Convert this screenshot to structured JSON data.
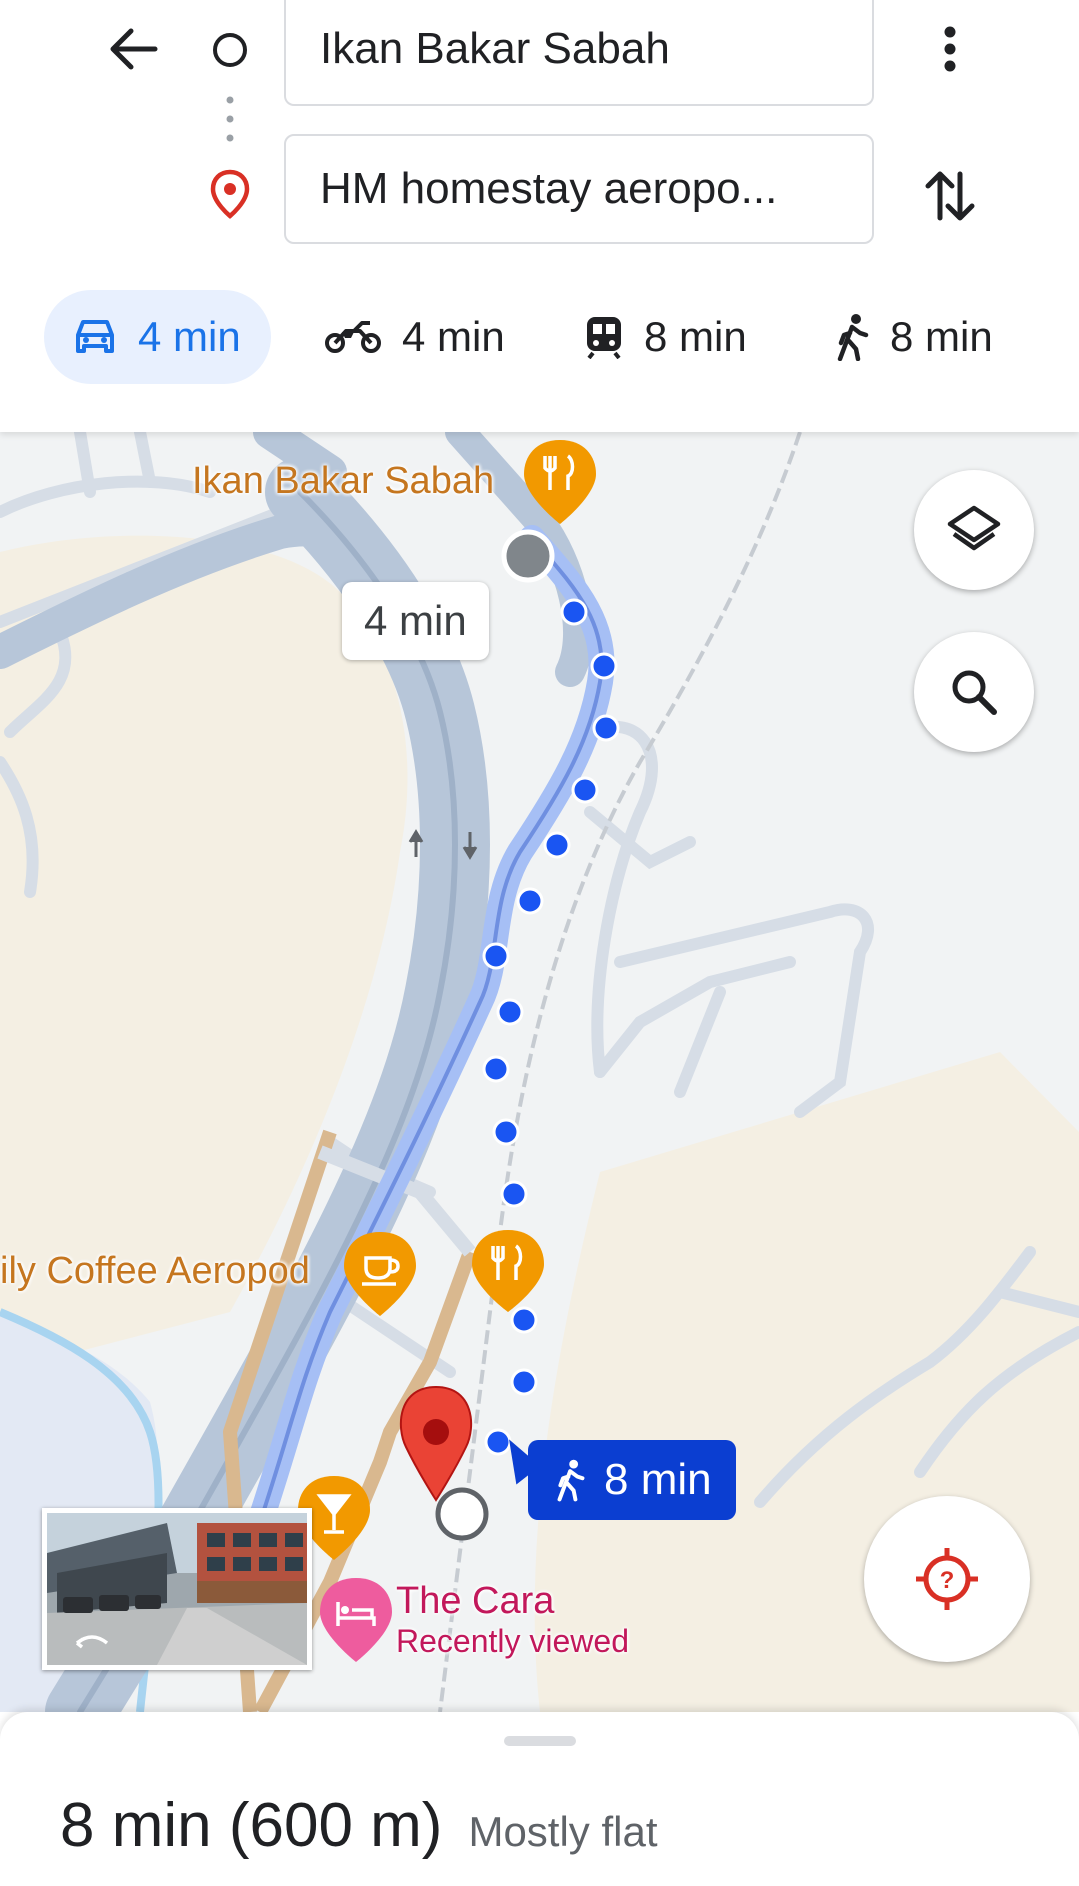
{
  "header": {
    "origin": "Ikan Bakar Sabah",
    "destination": "HM homestay aeropo..."
  },
  "modes": [
    {
      "name": "drive",
      "icon": "car-icon",
      "label": "4 min",
      "selected": true
    },
    {
      "name": "motorcycle",
      "icon": "motorcycle-icon",
      "label": "4 min",
      "selected": false
    },
    {
      "name": "transit",
      "icon": "train-icon",
      "label": "8 min",
      "selected": false
    },
    {
      "name": "walk",
      "icon": "walking-icon",
      "label": "8 min",
      "selected": false
    }
  ],
  "map": {
    "place_origin": "Ikan Bakar Sabah",
    "place_coffee": "ily Coffee Aeropod",
    "place_hotel": "The Cara",
    "place_hotel_note": "Recently viewed",
    "route_duration_bubble": "4 min",
    "walk_bubble": "8 min"
  },
  "sheet": {
    "summary": "8 min (600 m)",
    "terrain": "Mostly flat"
  },
  "colors": {
    "accent": "#1a73e8",
    "route_dots": "#1a55f2",
    "walk_bubble": "#0b3ed1",
    "poi_orange": "#f29900",
    "destination_pin": "#ea4335"
  }
}
